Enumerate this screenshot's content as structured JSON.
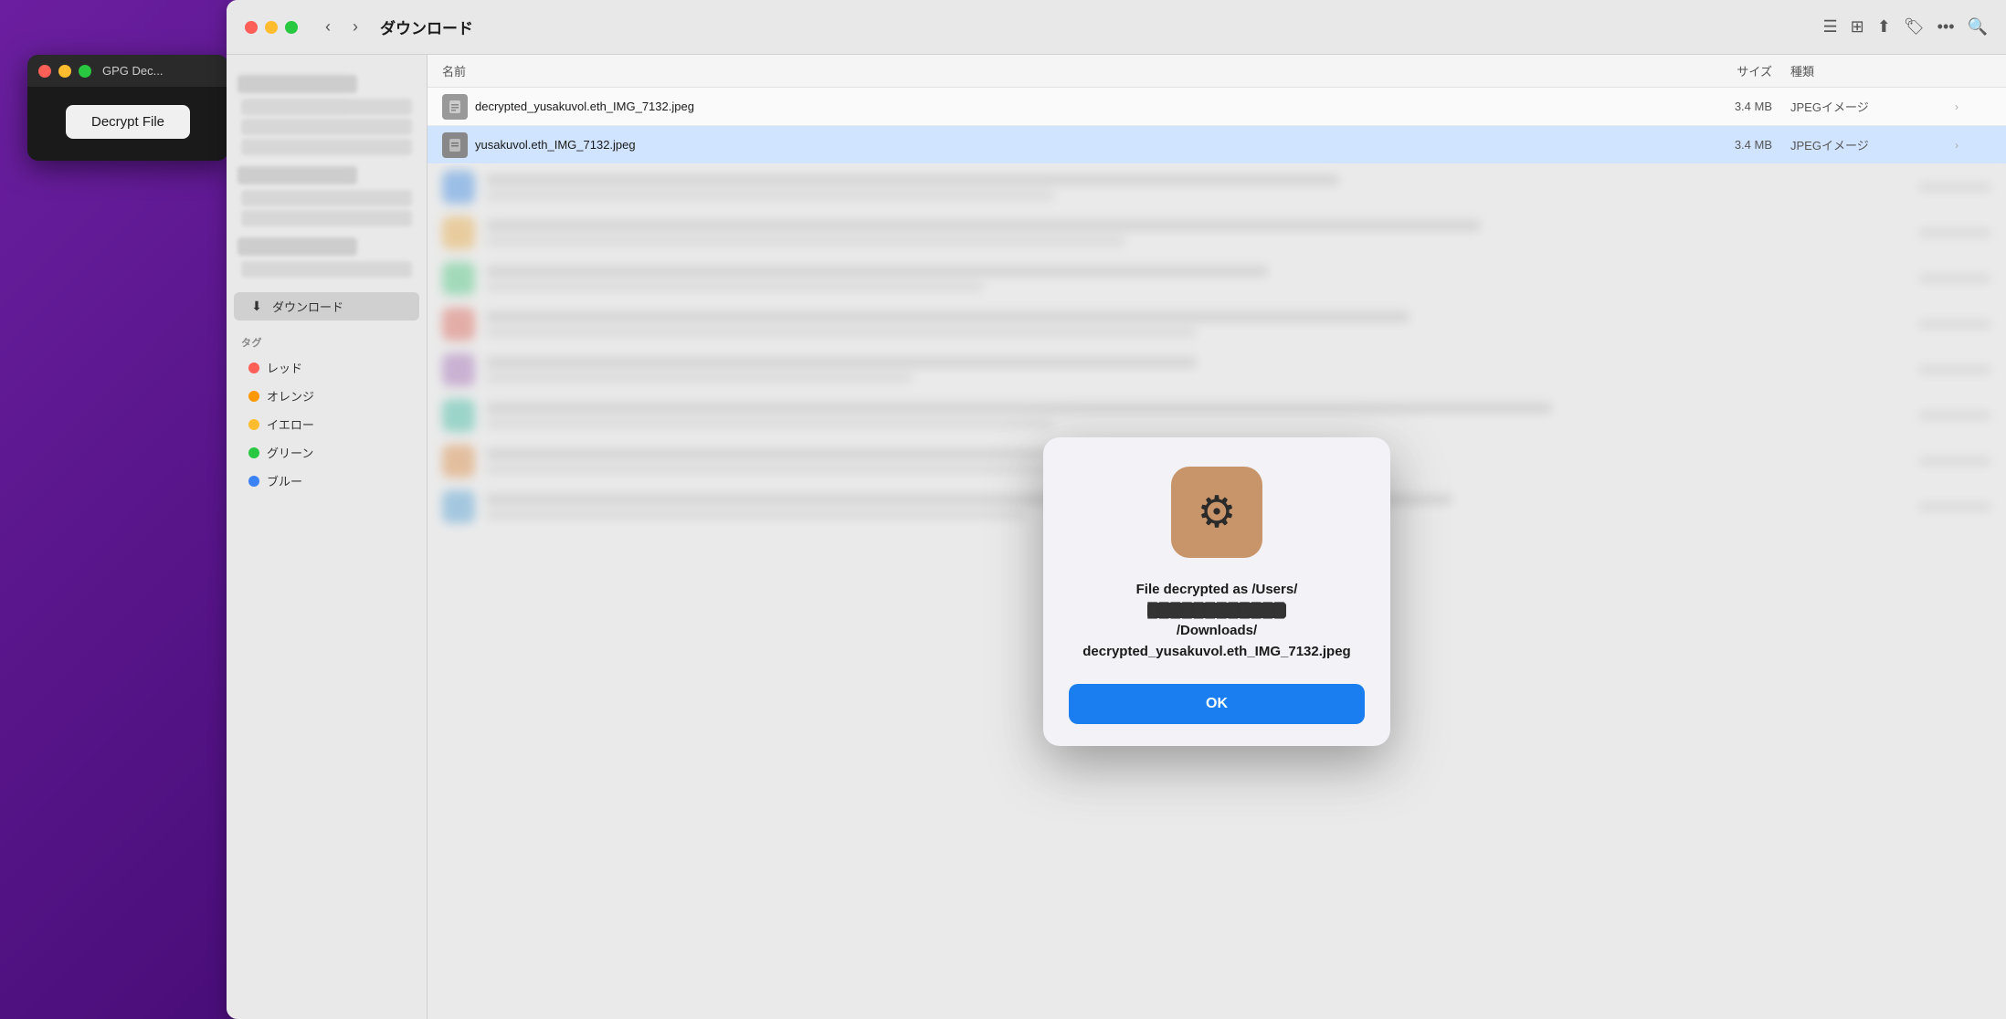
{
  "desktop": {
    "bg_color": "#5a1a8a"
  },
  "gpg_window": {
    "title": "GPG Dec...",
    "traffic_lights": [
      "close",
      "minimize",
      "maximize"
    ],
    "button_label": "Decrypt File"
  },
  "finder": {
    "toolbar": {
      "title": "ダウンロード",
      "back_label": "‹",
      "forward_label": "›"
    },
    "column_headers": {
      "name": "名前",
      "size": "サイズ",
      "kind": "種類"
    },
    "files": [
      {
        "name": "decrypted_yusakuvol.eth_IMG_7132.jpeg",
        "size": "3.4 MB",
        "kind": "JPEGイメージ",
        "selected": false
      },
      {
        "name": "yusakuvol.eth_IMG_7132.jpeg",
        "size": "3.4 MB",
        "kind": "JPEGイメージ",
        "selected": true
      }
    ],
    "sidebar": {
      "downloads_label": "ダウンロード",
      "tags_label": "タグ",
      "tags": [
        {
          "name": "レッド",
          "color": "#ff5f57"
        },
        {
          "name": "オレンジ",
          "color": "#ff9800"
        },
        {
          "name": "イエロー",
          "color": "#febc2e"
        },
        {
          "name": "グリーン",
          "color": "#28c840"
        },
        {
          "name": "ブルー",
          "color": "#3b82f6"
        }
      ]
    }
  },
  "dialog": {
    "icon": "⚙",
    "icon_bg_color": "#c8956a",
    "message": "File decrypted as /Users/\n████████████/Downloads/\ndecrypted_yusakuvol.eth_IMG_7\n132.jpeg",
    "message_parts": [
      "File decrypted as /Users/",
      "████████████",
      "/Downloads/",
      "decrypted_yusakuvol.eth_IMG_7132.jpeg"
    ],
    "ok_label": "OK",
    "ok_bg": "#1a7ef0"
  }
}
